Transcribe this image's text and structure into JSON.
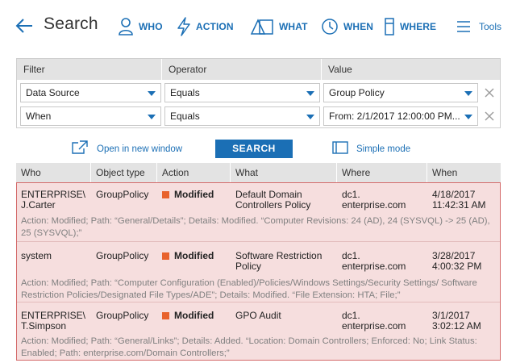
{
  "header": {
    "title": "Search",
    "nav": [
      {
        "label": "WHO",
        "icon": "person-icon"
      },
      {
        "label": "ACTION",
        "icon": "lightning-icon"
      },
      {
        "label": "WHAT",
        "icon": "shapes-icon"
      },
      {
        "label": "WHEN",
        "icon": "clock-icon"
      },
      {
        "label": "WHERE",
        "icon": "server-icon"
      }
    ],
    "tools_label": "Tools"
  },
  "filter": {
    "columns": [
      "Filter",
      "Operator",
      "Value"
    ],
    "rows": [
      {
        "filter": "Data Source",
        "operator": "Equals",
        "value": "Group Policy"
      },
      {
        "filter": "When",
        "operator": "Equals",
        "value": "From: 2/1/2017 12:00:00 PM..."
      }
    ]
  },
  "actions": {
    "open_new_window": "Open in new window",
    "search": "SEARCH",
    "simple_mode": "Simple mode"
  },
  "results": {
    "columns": [
      "Who",
      "Object type",
      "Action",
      "What",
      "Where",
      "When"
    ],
    "rows": [
      {
        "who": [
          "ENTERPRISE\\",
          "J.Carter"
        ],
        "object_type": "GroupPolicy",
        "action": "Modified",
        "what": [
          "Default Domain",
          "Controllers Policy"
        ],
        "where": [
          "dc1.",
          "enterprise.com"
        ],
        "when": [
          "4/18/2017",
          "11:42:31 AM"
        ],
        "details": "Action: Modified; Path: “General/Details”; Details: Modified. “Computer Revisions: 24 (AD), 24 (SYSVQL) -> 25 (AD), 25 (SYSVQL);”"
      },
      {
        "who": [
          "system",
          ""
        ],
        "object_type": "GroupPolicy",
        "action": "Modified",
        "what": [
          "Software Restriction",
          "Policy"
        ],
        "where": [
          "dc1.",
          "enterprise.com"
        ],
        "when": [
          "3/28/2017",
          "4:00:32 PM"
        ],
        "details": "Action: Modified; Path: “Computer Configuration (Enabled)/Policies/Windows Settings/Security Settings/ Software Restriction Policies/Designated File Types/ADE”; Details: Modified. “File Extension: HTA; File;”"
      },
      {
        "who": [
          "ENTERPRISE\\",
          "T.Simpson"
        ],
        "object_type": "GroupPolicy",
        "action": "Modified",
        "what": [
          "GPO Audit",
          ""
        ],
        "where": [
          "dc1.",
          "enterprise.com"
        ],
        "when": [
          "3/1/2017",
          "3:02:12 AM"
        ],
        "details": "Action: Modified; Path: “General/Links”; Details: Added. “Location: Domain Controllers; Enforced: No; Link Status: Enabled; Path: enterprise.com/Domain Controllers;”"
      }
    ]
  },
  "colors": {
    "accent": "#1b6fb5",
    "header_bg": "#e3e3e3",
    "result_bg": "#f6dede",
    "result_border": "#d46a6a",
    "modified_marker": "#e8622c"
  }
}
